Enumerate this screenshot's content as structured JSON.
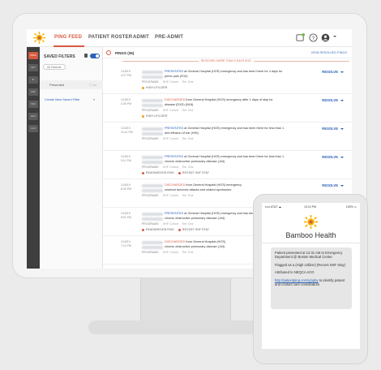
{
  "nav": {
    "tabs": [
      "PING FEED",
      "PATIENT ROSTER",
      "ADMIT",
      "PRE-ADMIT"
    ],
    "icons": [
      "notification-icon",
      "help-icon",
      "profile-icon"
    ]
  },
  "rail": {
    "tabs": [
      "PING",
      "ADT",
      "IP",
      "SNF",
      "SNF",
      "HHA",
      "ACO"
    ]
  },
  "filters": {
    "title": "SAVED FILTERS",
    "all_patients": "All Patients",
    "presented": "Presented",
    "presented_more": "ⓘ •••",
    "create": "Create New Saved Filter",
    "create_chevron": "▾"
  },
  "main": {
    "title": "PINGS (36)",
    "view_resolved": "VIEW RESOLVED PINGS",
    "received_banner": "RECEIVED MORE THAN 3 DAYS AGO",
    "pings": [
      {
        "date": "1/18/19",
        "time": "4:27 PM",
        "status": "PRESENTED",
        "line1": "at General Hospital (HOS) emergency and has been there for 4 days for",
        "line2": "pelvic pain (R10)",
        "program": "SHF Cohort",
        "program2": "Tier One",
        "flag": "HIGH UTILIZER",
        "flag_kind": "yellow",
        "resolve": "RESOLVE"
      },
      {
        "date": "1/18/19",
        "time": "4:35 PM",
        "status": "DISCHARGED",
        "line1": "from General Hospital (HOS) emergency after 1 days of stay for",
        "line2": "disease (DXD) (N18)",
        "program": "SHF Cohort",
        "program2": "Tier One",
        "flag": "HIGH UTILIZER",
        "flag_kind": "yellow",
        "resolve": "RESOLVE"
      },
      {
        "date": "1/18/19",
        "time": "10:11 PM",
        "status": "PRESENTED",
        "line1": "at General Hospital (HOS) emergency and has been there for less than 1",
        "line2": "and effusion of ear (H92)",
        "program": "SHF Cohort",
        "program2": "Tier One",
        "flag": "",
        "flag_kind": "",
        "resolve": "RESOLVE"
      },
      {
        "date": "1/18/19",
        "time": "9:11 PM",
        "status": "PRESENTED",
        "line1": "at General Hospital (HOS) emergency and has been there for less than 1",
        "line2": "chronic obstructive pulmonary disease (J44)",
        "program": "SHF Cohort",
        "program2": "Tier One",
        "flag": "READMISSION RISK",
        "flag2": "RECENT SNF STAY",
        "flag_kind": "red",
        "resolve": "RESOLVE"
      },
      {
        "date": "1/18/19",
        "time": "8:30 PM",
        "status": "DISCHARGED",
        "line1": "from General Hospital (HOS) emergency",
        "line2": "cerebral ischemic attacks and related syndromes",
        "program": "SHF Cohort",
        "program2": "Tier One",
        "flag": "",
        "flag_kind": "",
        "resolve": "RESOLVE"
      },
      {
        "date": "1/18/19",
        "time": "8:01 PM",
        "status": "PRESENTED",
        "line1": "at General Hospital (HOS) emergency and has been there for",
        "line2": "chronic obstructive pulmonary disease (J44)",
        "program": "SHF Cohort",
        "program2": "Tier One",
        "flag": "READMISSION RISK",
        "flag2": "RECENT SNF STAY",
        "flag_kind": "red",
        "resolve": "RESOLVE"
      },
      {
        "date": "1/18/19",
        "time": "7:11 PM",
        "status": "DISCHARGED",
        "line1": "from General Hospital (HOS)",
        "line2": "chronic obstructive pulmonary disease (J44)",
        "program": "SHF Cohort",
        "program2": "Tier One",
        "flag": "",
        "flag_kind": "",
        "resolve": "RESOLVE"
      }
    ]
  },
  "phone": {
    "carrier": "••••• AT&T ☁",
    "time": "12:14 PM",
    "battery": "100% ▭",
    "brand": "Bamboo Health",
    "messages": [
      "Patient presented at 12:31 AM to Emergency Department @ Boston Medical Center.",
      "Flagged as a (High Utilizer) (Recent SNF Stay)",
      "Attributed to NEQCA ACO"
    ],
    "link": "http://patientping.com/y/ppby",
    "link_suffix": " to identify patient and contact care coordinators"
  }
}
